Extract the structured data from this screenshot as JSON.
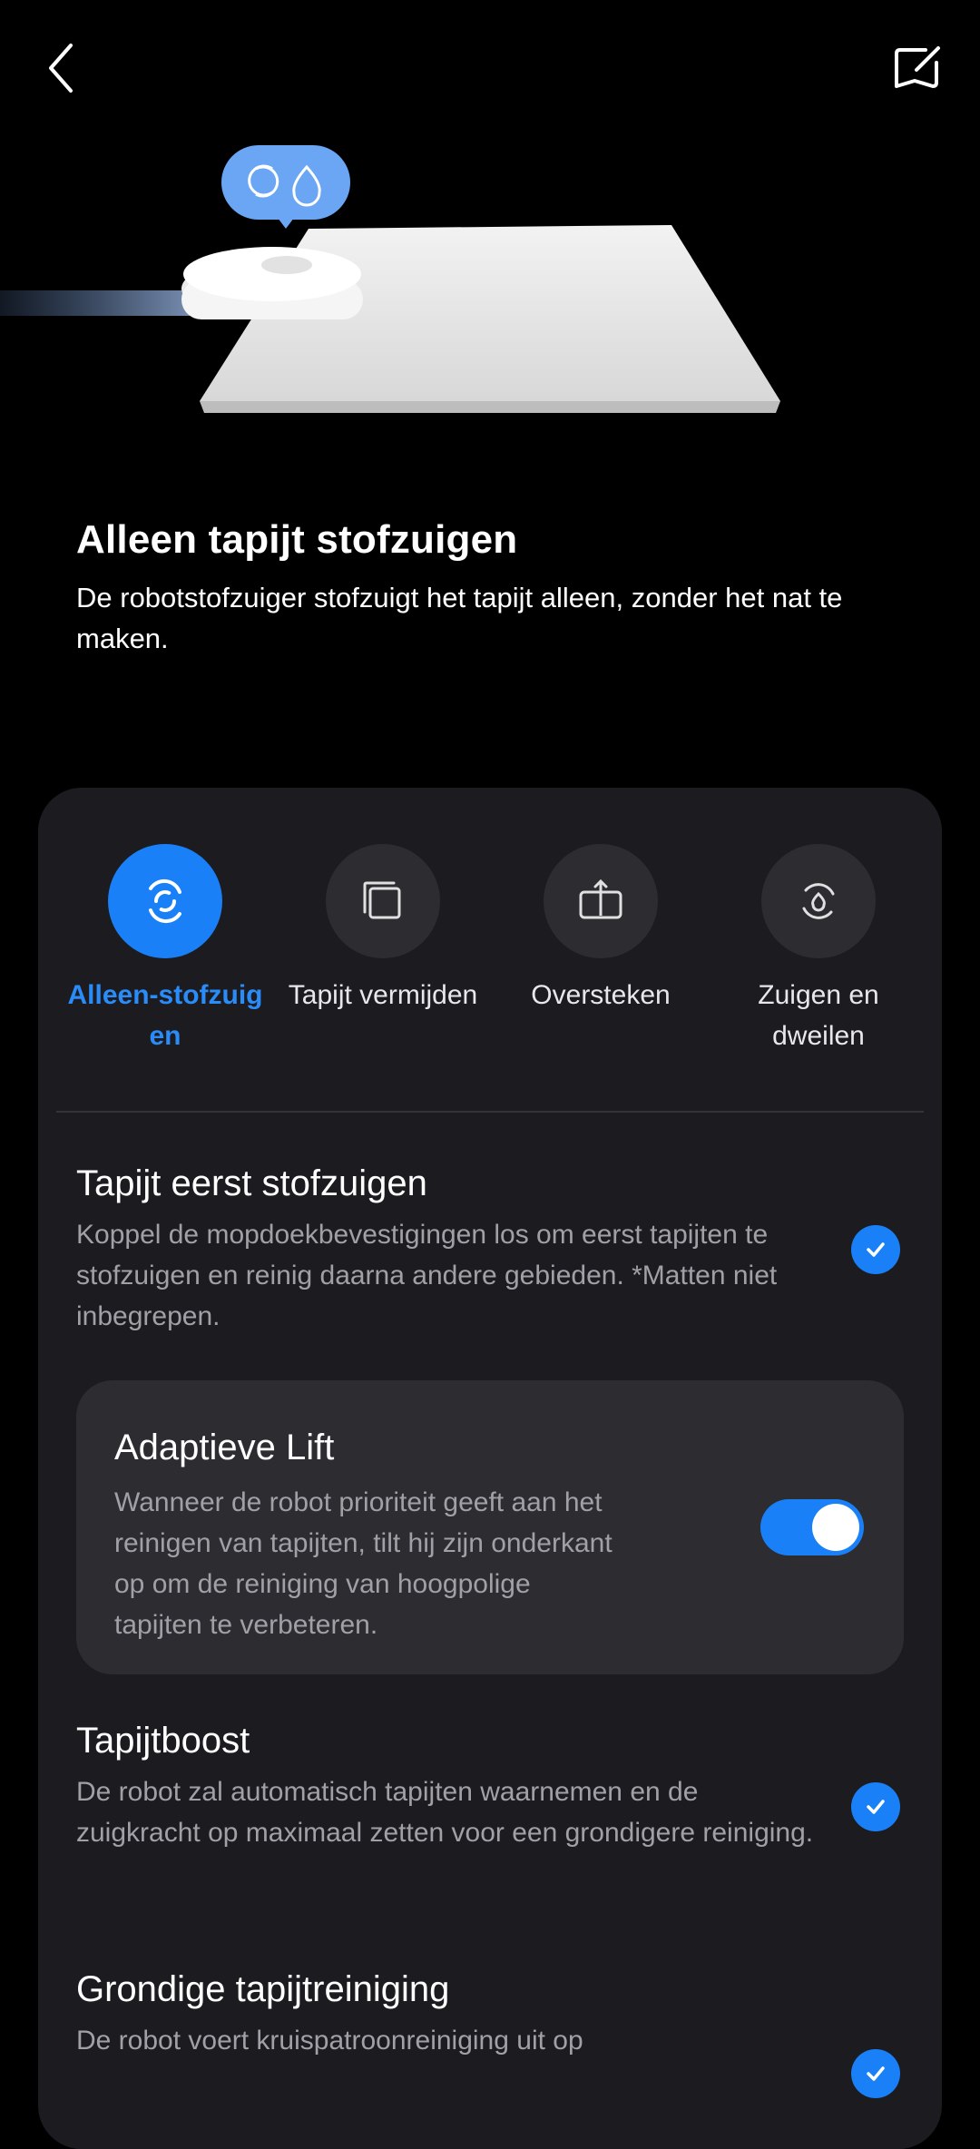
{
  "header": {
    "back_icon": "chevron-left-icon",
    "edit_icon": "edit-square-icon"
  },
  "hero": {
    "badge_icons": [
      "vacuum-swirl-icon",
      "water-drop-icon"
    ]
  },
  "intro": {
    "title": "Alleen tapijt stofzuigen",
    "description": "De robotstofzuiger stofzuigt het tapijt alleen, zonder het nat te maken."
  },
  "modes": [
    {
      "label": "Alleen-stofzuig en",
      "icon": "swirl-icon",
      "active": true
    },
    {
      "label": "Tapijt vermijden",
      "icon": "rug-avoid-icon",
      "active": false
    },
    {
      "label": "Oversteken",
      "icon": "cross-over-icon",
      "active": false
    },
    {
      "label": "Zuigen en dweilen",
      "icon": "vacuum-mop-icon",
      "active": false
    }
  ],
  "options": {
    "vacuum_first": {
      "title": "Tapijt eerst stofzuigen",
      "description": "Koppel de mopdoekbevestigingen los om eerst tapijten te stofzuigen en reinig daarna andere gebieden. *Matten niet inbegrepen.",
      "checked": true
    },
    "adaptive_lift": {
      "title": "Adaptieve Lift",
      "description": "Wanneer de robot prioriteit geeft aan het reinigen van tapijten, tilt hij zijn onderkant op om de reiniging van hoogpolige tapijten te verbeteren.",
      "enabled": true
    },
    "boost": {
      "title": "Tapijtboost",
      "description": "De robot zal automatisch tapijten waarnemen en de zuigkracht op maximaal zetten voor een grondigere reiniging.",
      "checked": true
    },
    "deep_clean": {
      "title": "Grondige tapijtreiniging",
      "description": "De robot voert kruispatroonreiniging uit op",
      "checked": true
    }
  },
  "colors": {
    "accent": "#1a80f7",
    "panel": "#1c1c20",
    "subcard": "#2c2c31"
  }
}
